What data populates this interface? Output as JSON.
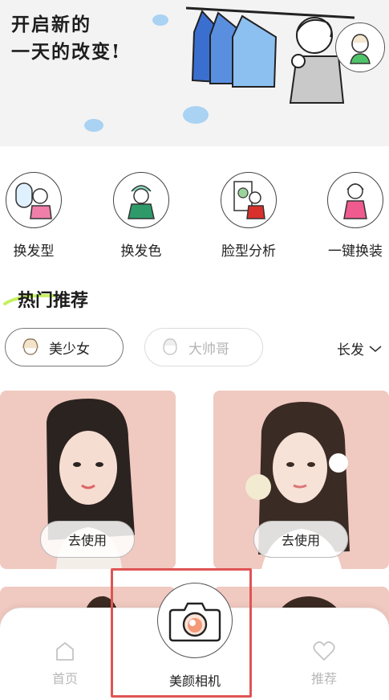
{
  "hero": {
    "line1": "开启新的",
    "line2": "一天的改变!"
  },
  "features": [
    {
      "label": "换发型",
      "icon": "mirror-hairstyle-icon"
    },
    {
      "label": "换发色",
      "icon": "hair-dye-icon"
    },
    {
      "label": "脸型分析",
      "icon": "face-analysis-icon"
    },
    {
      "label": "一键换装",
      "icon": "outfit-change-icon"
    }
  ],
  "section": {
    "title": "热门推荐"
  },
  "filters": {
    "female": "美少女",
    "male": "大帅哥",
    "sort": "长发"
  },
  "cards": [
    {
      "button": "去使用"
    },
    {
      "button": "去使用"
    }
  ],
  "bottom_nav": {
    "home": "首页",
    "camera": "美颜相机",
    "recommend": "推荐"
  },
  "colors": {
    "card_bg": "#f0c9c0",
    "accent_dot": "#a9d2f3",
    "highlight": "#e05454",
    "inactive": "#b8b8b8"
  }
}
